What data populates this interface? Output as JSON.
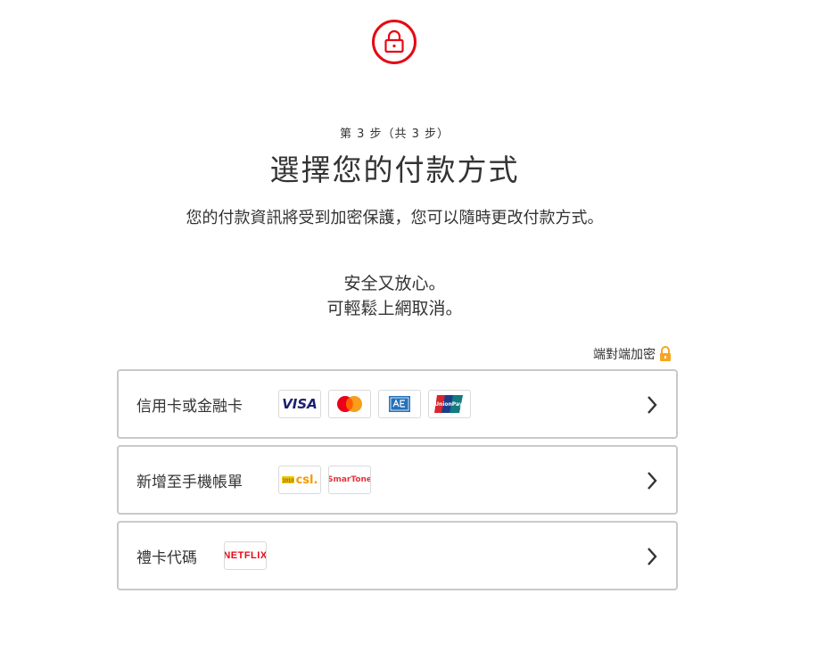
{
  "header": {
    "lock_icon": "lock-icon",
    "step": "第 3 步（共 3 步）",
    "title": "選擇您的付款方式",
    "description": "您的付款資訊將受到加密保護，您可以隨時更改付款方式。",
    "safe_line1": "安全又放心。",
    "safe_line2": "可輕鬆上網取消。"
  },
  "encryption": {
    "label": "端對端加密",
    "icon": "padlock-icon"
  },
  "options": [
    {
      "label": "信用卡或金融卡",
      "logos": [
        "VISA",
        "mastercard",
        "amex",
        "unionpay"
      ]
    },
    {
      "label": "新增至手機帳單",
      "logos": [
        "csl.",
        "SmarTone"
      ]
    },
    {
      "label": "禮卡代碼",
      "logos": [
        "NETFLIX"
      ]
    }
  ],
  "colors": {
    "accent": "#e50914",
    "encrypt_lock": "#f5a623",
    "border": "#c9c9c9",
    "text": "#333333"
  }
}
